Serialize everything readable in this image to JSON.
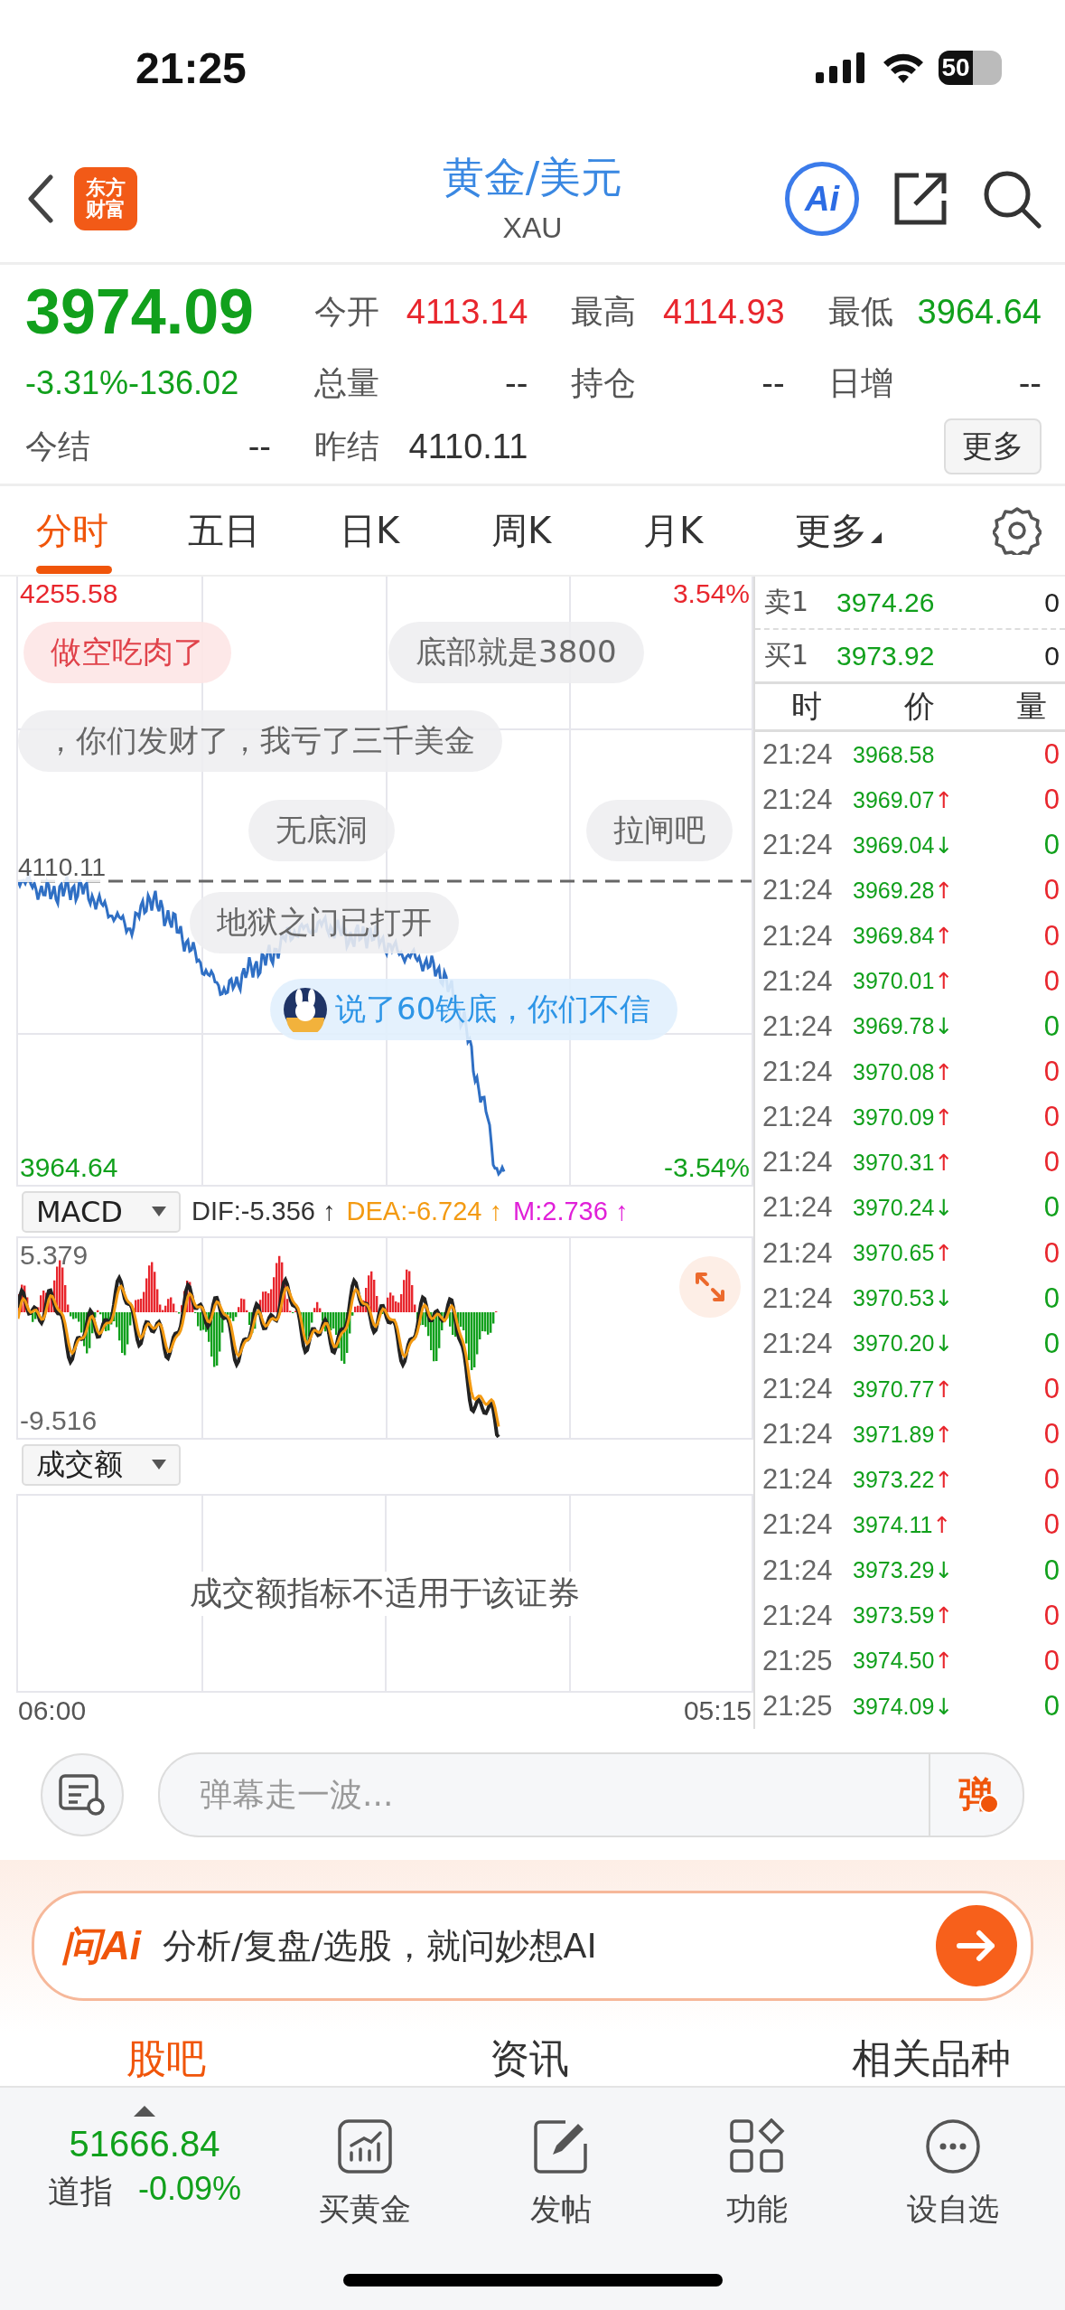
{
  "status_bar": {
    "time": "21:25",
    "battery": "50"
  },
  "header": {
    "logo_lines": [
      "东方",
      "财富"
    ],
    "title": "黄金/美元",
    "subtitle": "XAU",
    "ai_badge": "Ai"
  },
  "quote": {
    "price": "3974.09",
    "change": "-3.31%-136.02",
    "settle": {
      "label": "今结",
      "value": "--"
    },
    "stats": [
      {
        "label": "今开",
        "value": "4113.14",
        "kind": "up"
      },
      {
        "label": "最高",
        "value": "4114.93",
        "kind": "up"
      },
      {
        "label": "最低",
        "value": "3964.64",
        "kind": "down"
      },
      {
        "label": "总量",
        "value": "--",
        "kind": "flat"
      },
      {
        "label": "持仓",
        "value": "--",
        "kind": "flat"
      },
      {
        "label": "日增",
        "value": "--",
        "kind": "flat"
      },
      {
        "label": "昨结",
        "value": "4110.11",
        "kind": "flat"
      }
    ],
    "more_button": "更多"
  },
  "period_tabs": [
    {
      "label": "分时",
      "selected": true,
      "kind": "tab"
    },
    {
      "label": "五日",
      "selected": false,
      "kind": "tab"
    },
    {
      "label": "日K",
      "selected": false,
      "kind": "tab"
    },
    {
      "label": "周K",
      "selected": false,
      "kind": "tab"
    },
    {
      "label": "月K",
      "selected": false,
      "kind": "tab"
    },
    {
      "label": "更多",
      "selected": false,
      "kind": "menu"
    }
  ],
  "chart": {
    "high": "4255.58",
    "high_pct": "3.54%",
    "low": "3964.64",
    "low_pct": "-3.54%",
    "prev_close": "4110.11",
    "start_time": "06:00",
    "end_time": "05:15"
  },
  "danmaku": [
    {
      "text": "做空吃肉了",
      "kind": "highlight"
    },
    {
      "text": "底部就是3800",
      "kind": "plain"
    },
    {
      "text": "，你们发财了，我亏了三千美金",
      "kind": "plain"
    },
    {
      "text": "无底洞",
      "kind": "plain"
    },
    {
      "text": "拉闸吧",
      "kind": "plain"
    },
    {
      "text": "地狱之门已打开",
      "kind": "plain"
    },
    {
      "text": "说了60铁底，你们不信",
      "kind": "own"
    }
  ],
  "indicator": {
    "name": "MACD",
    "dif": "DIF:-5.356 ↑",
    "dea": "DEA:-6.724 ↑",
    "m": "M:2.736 ↑",
    "max": "5.379",
    "min": "-9.516"
  },
  "volume_panel": {
    "name": "成交额",
    "message": "成交额指标不适用于该证券"
  },
  "order_book": [
    {
      "label": "卖1",
      "price": "3974.26",
      "volume": "0"
    },
    {
      "label": "买1",
      "price": "3973.92",
      "volume": "0"
    }
  ],
  "ticks": {
    "columns": [
      "时",
      "价",
      "量"
    ],
    "rows": [
      {
        "time": "21:24",
        "price": "3968.58",
        "kind": "flat",
        "volume": "0"
      },
      {
        "time": "21:24",
        "price": "3969.07",
        "arrow": "↑",
        "kind": "up",
        "volume": "0"
      },
      {
        "time": "21:24",
        "price": "3969.04",
        "arrow": "↓",
        "kind": "down",
        "volume": "0"
      },
      {
        "time": "21:24",
        "price": "3969.28",
        "arrow": "↑",
        "kind": "up",
        "volume": "0"
      },
      {
        "time": "21:24",
        "price": "3969.84",
        "arrow": "↑",
        "kind": "up",
        "volume": "0"
      },
      {
        "time": "21:24",
        "price": "3970.01",
        "arrow": "↑",
        "kind": "up",
        "volume": "0"
      },
      {
        "time": "21:24",
        "price": "3969.78",
        "arrow": "↓",
        "kind": "down",
        "volume": "0"
      },
      {
        "time": "21:24",
        "price": "3970.08",
        "arrow": "↑",
        "kind": "up",
        "volume": "0"
      },
      {
        "time": "21:24",
        "price": "3970.09",
        "arrow": "↑",
        "kind": "up",
        "volume": "0"
      },
      {
        "time": "21:24",
        "price": "3970.31",
        "arrow": "↑",
        "kind": "up",
        "volume": "0"
      },
      {
        "time": "21:24",
        "price": "3970.24",
        "arrow": "↓",
        "kind": "down",
        "volume": "0"
      },
      {
        "time": "21:24",
        "price": "3970.65",
        "arrow": "↑",
        "kind": "up",
        "volume": "0"
      },
      {
        "time": "21:24",
        "price": "3970.53",
        "arrow": "↓",
        "kind": "down",
        "volume": "0"
      },
      {
        "time": "21:24",
        "price": "3970.20",
        "arrow": "↓",
        "kind": "down",
        "volume": "0"
      },
      {
        "time": "21:24",
        "price": "3970.77",
        "arrow": "↑",
        "kind": "up",
        "volume": "0"
      },
      {
        "time": "21:24",
        "price": "3971.89",
        "arrow": "↑",
        "kind": "up",
        "volume": "0"
      },
      {
        "time": "21:24",
        "price": "3973.22",
        "arrow": "↑",
        "kind": "up",
        "volume": "0"
      },
      {
        "time": "21:24",
        "price": "3974.11",
        "arrow": "↑",
        "kind": "up",
        "volume": "0"
      },
      {
        "time": "21:24",
        "price": "3973.29",
        "arrow": "↓",
        "kind": "down",
        "volume": "0"
      },
      {
        "time": "21:24",
        "price": "3973.59",
        "arrow": "↑",
        "kind": "up",
        "volume": "0"
      },
      {
        "time": "21:25",
        "price": "3974.50",
        "arrow": "↑",
        "kind": "up",
        "volume": "0"
      },
      {
        "time": "21:25",
        "price": "3974.09",
        "arrow": "↓",
        "kind": "down",
        "volume": "0"
      }
    ]
  },
  "comment_bar": {
    "placeholder": "弹幕走一波...",
    "send_label": "弹"
  },
  "ai_bar": {
    "logo": "问Ai",
    "prompt": "分析/复盘/选股，就问妙想AI"
  },
  "section_tabs": [
    {
      "label": "股吧",
      "selected": true
    },
    {
      "label": "资讯",
      "selected": false
    },
    {
      "label": "相关品种",
      "selected": false
    }
  ],
  "bottom_bar": {
    "index_value": "51666.84",
    "index_name": "道指",
    "index_change": "-0.09%",
    "actions": [
      {
        "label": "买黄金",
        "kind": "chart"
      },
      {
        "label": "发帖",
        "kind": "edit"
      },
      {
        "label": "功能",
        "kind": "grid"
      },
      {
        "label": "设自选",
        "kind": "more"
      }
    ]
  }
}
